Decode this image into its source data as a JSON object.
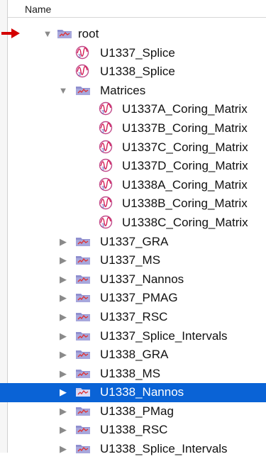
{
  "header": {
    "column_name": "Name"
  },
  "tree": [
    {
      "label": "root",
      "kind": "folder",
      "expanded": true,
      "marked": true
    },
    {
      "label": "U1337_Splice",
      "kind": "item"
    },
    {
      "label": "U1338_Splice",
      "kind": "item"
    },
    {
      "label": "Matrices",
      "kind": "folder",
      "expanded": true
    },
    {
      "label": "U1337A_Coring_Matrix",
      "kind": "item"
    },
    {
      "label": "U1337B_Coring_Matrix",
      "kind": "item"
    },
    {
      "label": "U1337C_Coring_Matrix",
      "kind": "item"
    },
    {
      "label": "U1337D_Coring_Matrix",
      "kind": "item"
    },
    {
      "label": "U1338A_Coring_Matrix",
      "kind": "item"
    },
    {
      "label": "U1338B_Coring_Matrix",
      "kind": "item"
    },
    {
      "label": "U1338C_Coring_Matrix",
      "kind": "item"
    },
    {
      "label": "U1337_GRA",
      "kind": "folder",
      "expanded": false
    },
    {
      "label": "U1337_MS",
      "kind": "folder",
      "expanded": false
    },
    {
      "label": "U1337_Nannos",
      "kind": "folder",
      "expanded": false
    },
    {
      "label": "U1337_PMAG",
      "kind": "folder",
      "expanded": false
    },
    {
      "label": "U1337_RSC",
      "kind": "folder",
      "expanded": false
    },
    {
      "label": "U1337_Splice_Intervals",
      "kind": "folder",
      "expanded": false
    },
    {
      "label": "U1338_GRA",
      "kind": "folder",
      "expanded": false
    },
    {
      "label": "U1338_MS",
      "kind": "folder",
      "expanded": false
    },
    {
      "label": "U1338_Nannos",
      "kind": "folder",
      "expanded": false,
      "selected": true
    },
    {
      "label": "U1338_PMag",
      "kind": "folder",
      "expanded": false
    },
    {
      "label": "U1338_RSC",
      "kind": "folder",
      "expanded": false
    },
    {
      "label": "U1338_Splice_Intervals",
      "kind": "folder",
      "expanded": false
    }
  ],
  "colors": {
    "selection": "#0a63d6",
    "marker": "#d40000",
    "folder": "#8f8fcf"
  },
  "icons": {
    "expanded": "disclosure-down-icon",
    "collapsed": "disclosure-right-icon",
    "folder": "data-folder-icon",
    "item": "waveform-doc-icon",
    "marker": "red-arrow-icon"
  }
}
